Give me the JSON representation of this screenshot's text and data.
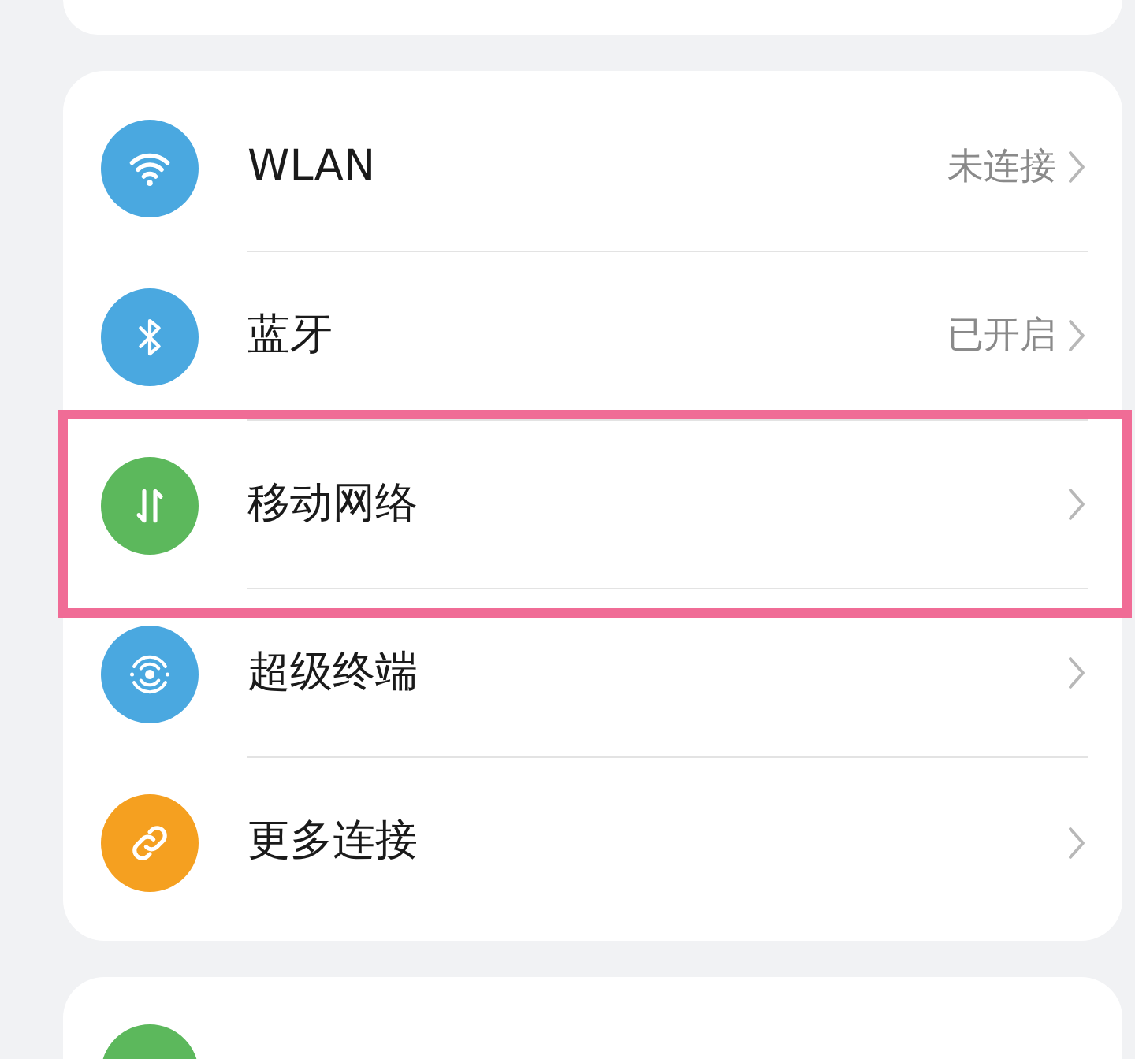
{
  "settings_rows": [
    {
      "kind": "wifi",
      "color": "#4aa8e0",
      "label": "WLAN",
      "value": "未连接",
      "highlighted": false
    },
    {
      "kind": "bluetooth",
      "color": "#4aa8e0",
      "label": "蓝牙",
      "value": "已开启",
      "highlighted": false
    },
    {
      "kind": "mobile",
      "color": "#5cb85c",
      "label": "移动网络",
      "highlighted": true
    },
    {
      "kind": "superdevice",
      "color": "#4aa8e0",
      "label": "超级终端",
      "highlighted": false
    },
    {
      "kind": "link",
      "color": "#f5a020",
      "label": "更多连接",
      "highlighted": false
    }
  ]
}
